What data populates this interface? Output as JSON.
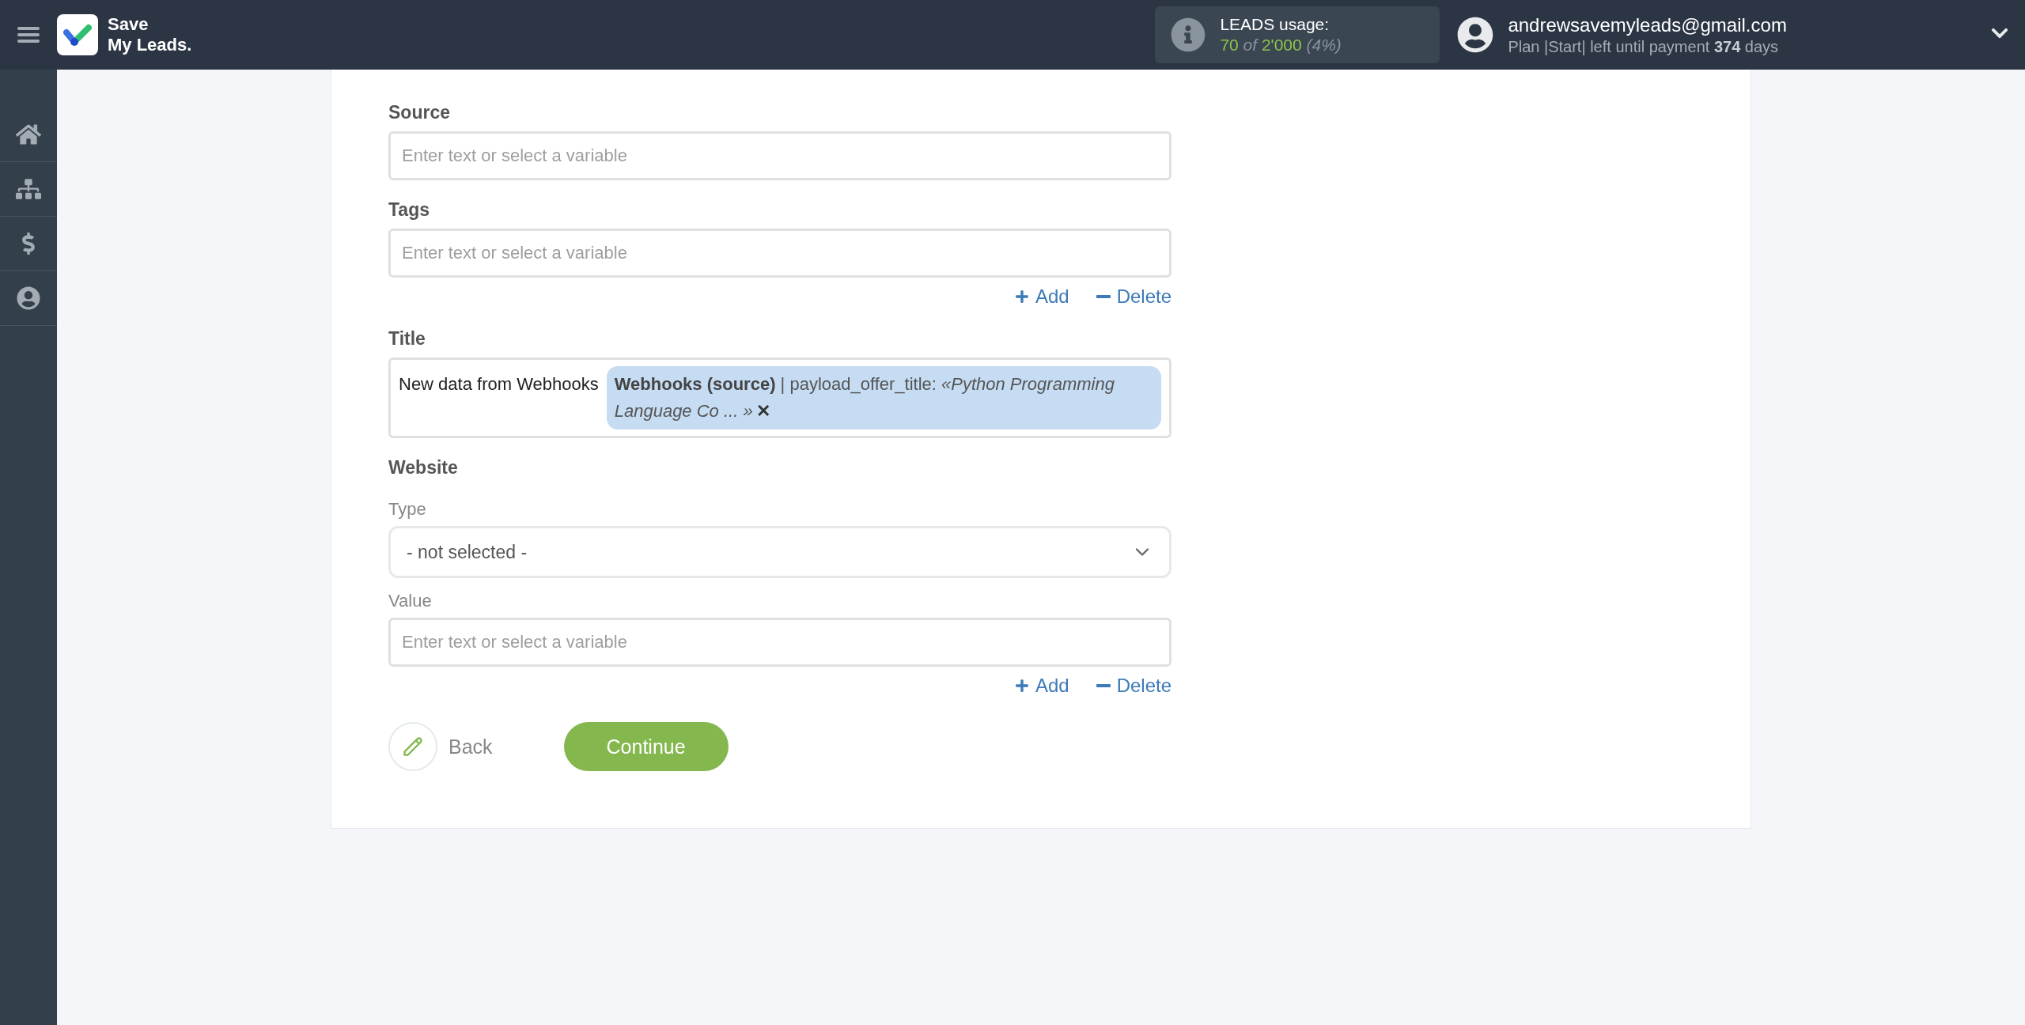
{
  "header": {
    "brand": [
      "Save",
      "My Leads."
    ],
    "usage": {
      "label": "LEADS usage:",
      "used": "70",
      "of": "of",
      "total": "2'000",
      "percent": "(4%)"
    },
    "user": {
      "email": "andrewsavemyleads@gmail.com",
      "plan": "Plan |Start| left until payment **374** days"
    }
  },
  "form": {
    "fields": [
      {
        "kind": "text",
        "label": "Source",
        "sub": false,
        "placeholder": "Enter text or select a variable"
      },
      {
        "kind": "text",
        "label": "Tags",
        "sub": false,
        "placeholder": "Enter text or select a variable",
        "actions": {
          "add": "Add",
          "delete": "Delete"
        }
      },
      {
        "kind": "mapped",
        "label": "Title",
        "sub": false,
        "text": "New data from Webhooks",
        "tag": {
          "text": "**Webhooks (source)** | payload_offer_title: *«Python Programming Language Co ... »*",
          "remove": "✕"
        }
      },
      {
        "kind": "heading",
        "label": "Website"
      },
      {
        "kind": "select",
        "label": "Type",
        "sub": true,
        "value": "- not selected -"
      },
      {
        "kind": "text",
        "label": "Value",
        "sub": true,
        "placeholder": "Enter text or select a variable",
        "actions": {
          "add": "Add",
          "delete": "Delete"
        }
      }
    ],
    "back": "Back",
    "continue": "Continue"
  }
}
